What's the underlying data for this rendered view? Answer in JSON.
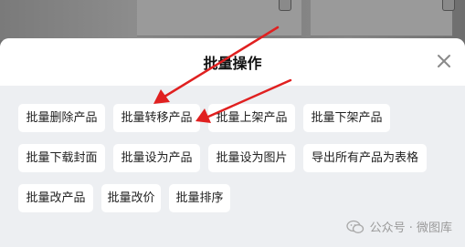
{
  "sheet": {
    "title": "批量操作"
  },
  "operations": [
    "批量删除产品",
    "批量转移产品",
    "批量上架产品",
    "批量下架产品",
    "批量下载封面",
    "批量设为产品",
    "批量设为图片",
    "导出所有产品为表格",
    "批量改产品",
    "批量改价",
    "批量排序"
  ],
  "watermark": {
    "text": "公众号 · 微图库"
  },
  "icons": {
    "close": "close-icon",
    "arrow": "arrow-annotation",
    "wechat": "wechat-icon"
  },
  "colors": {
    "arrow": "#e02020",
    "button_bg": "#ffffff",
    "sheet_bg": "#edeff2"
  }
}
